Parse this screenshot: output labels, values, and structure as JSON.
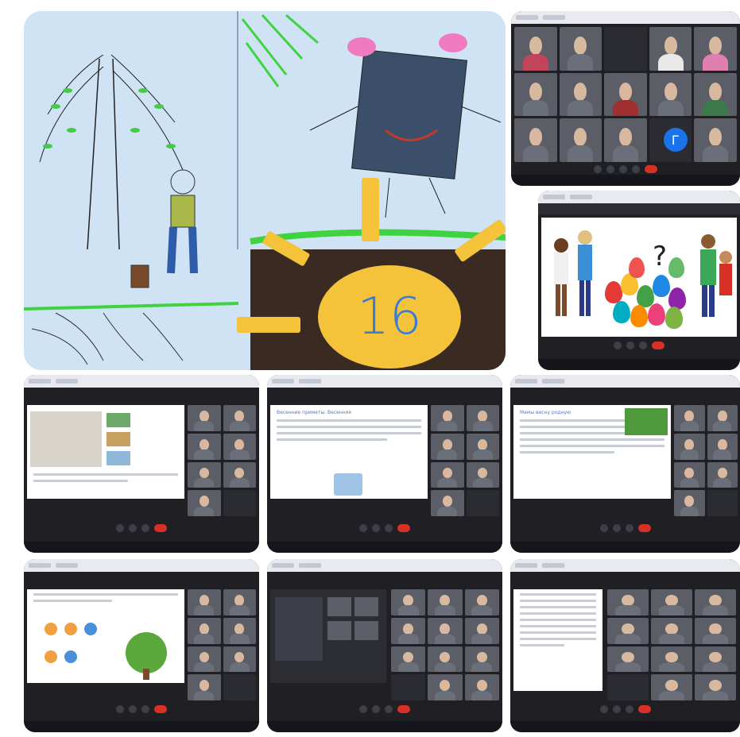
{
  "collage": {
    "drawing": {
      "sun_number": "16",
      "colors": {
        "paper": "#cfe3f5",
        "sun": "#f4c33a",
        "soil": "#3a2a22",
        "grass": "#3fd33f",
        "number": "#3a7bd5"
      }
    },
    "call_screens": {
      "avatar_letter": "Г",
      "slide_heading_a": "Весенние приметы. Весенняя",
      "slide_heading_b": "Мамы весну родную"
    }
  }
}
